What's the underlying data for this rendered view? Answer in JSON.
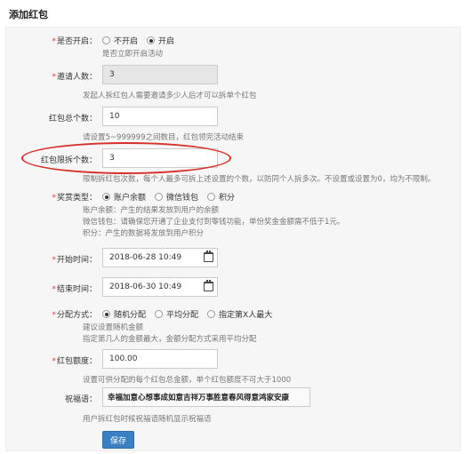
{
  "page_title": "添加红包",
  "form": {
    "enable": {
      "label": "是否开启：",
      "options": [
        "不开启",
        "开启"
      ],
      "selected": 1,
      "help": "是否立即开启活动"
    },
    "invite": {
      "label": "邀请人数：",
      "value": "3",
      "help": "发起人拆红包人需要邀请多少人后才可以拆单个红包"
    },
    "total": {
      "label": "红包总个数：",
      "value": "10",
      "help": "请设置5~999999之间数目，红包领完活动结束"
    },
    "limit": {
      "label": "红包限拆个数：",
      "value": "3",
      "help": "限制拆红包次数，每个人最多可拆上述设置的个数，以防同个人拆多次。不设置或设置为0，均为不限制。"
    },
    "prize": {
      "label": "奖赏类型：",
      "options": [
        "账户余额",
        "微信钱包",
        "积分"
      ],
      "selected": 0,
      "help1": "账户余额：产生的结果发放到用户的余额",
      "help2": "微信钱包：请确保您开通了企业支付到零钱功能，单份奖金金额需不低于1元。",
      "help3": "积分：产生的数据将发放到用户积分"
    },
    "start": {
      "label": "开始时间：",
      "value": "2018-06-28 10:49"
    },
    "end": {
      "label": "结束时间：",
      "value": "2018-06-30 10:49"
    },
    "distribution": {
      "label": "分配方式：",
      "options": [
        "随机分配",
        "平均分配",
        "指定第X人最大"
      ],
      "selected": 0,
      "help1": "建议设置随机金额",
      "help2": "指定第几人的金额最大，金额分配方式采用平均分配"
    },
    "amount": {
      "label": "红包额度：",
      "value": "100.00",
      "help": "设置可供分配的每个红包总金额，单个红包额度不可大于1000"
    },
    "blessing": {
      "label": "祝福语：",
      "value": "幸福加意心想事成如意吉祥万事胜意春风得意鸿家安康",
      "help": "用户拆红包时候祝福语随机显示祝福语"
    },
    "save_label": "保存"
  }
}
